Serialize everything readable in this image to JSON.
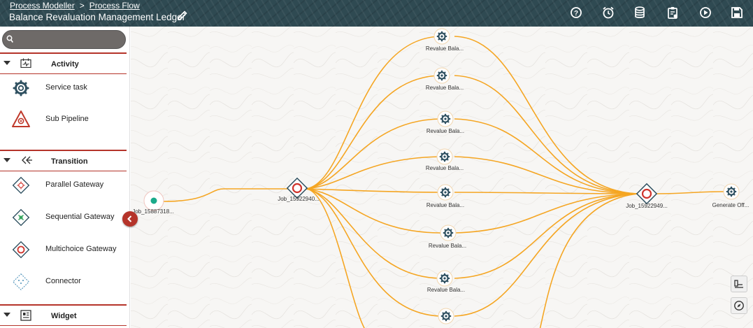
{
  "breadcrumb": {
    "parent": "Process Modeller",
    "separator": ">",
    "current": "Process Flow"
  },
  "header": {
    "title": "Balance Revaluation Management Ledger",
    "icons": [
      "help-icon",
      "alarm-clock-icon",
      "database-icon",
      "clipboard-icon",
      "play-icon",
      "save-icon"
    ]
  },
  "search": {
    "placeholder": ""
  },
  "palette": {
    "activity": {
      "label": "Activity",
      "items": [
        {
          "label": "Service task"
        },
        {
          "label": "Sub Pipeline"
        }
      ]
    },
    "transition": {
      "label": "Transition",
      "items": [
        {
          "label": "Parallel Gateway"
        },
        {
          "label": "Sequential Gateway"
        },
        {
          "label": "Multichoice Gateway"
        },
        {
          "label": "Connector"
        }
      ]
    },
    "widget": {
      "label": "Widget"
    }
  },
  "flow": {
    "start": {
      "label": "Job_15887318..."
    },
    "gateway_split": {
      "label": "Job_15922940..."
    },
    "gateway_join": {
      "label": "Job_15922949..."
    },
    "tasks": [
      {
        "label": "Revalue Bala..."
      },
      {
        "label": "Revalue Bala..."
      },
      {
        "label": "Revalue Bala..."
      },
      {
        "label": "Revalue Bala..."
      },
      {
        "label": "Revalue Bala..."
      },
      {
        "label": "Revalue Bala..."
      },
      {
        "label": "Revalue Bala..."
      },
      {
        "label": ""
      }
    ],
    "end_task": {
      "label": "Generate Off..."
    }
  },
  "colors": {
    "header": "#2f4a52",
    "accent": "#b5342a",
    "connector": "#f5a623",
    "gateway": "#d0342c",
    "start": "#1aaa8a"
  }
}
